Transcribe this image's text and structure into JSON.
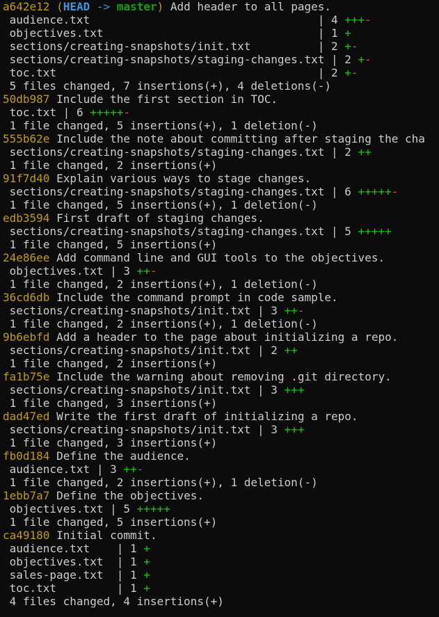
{
  "terminal": {
    "colors": {
      "background": "#0c0c0c",
      "text": "#cccccc",
      "hash": "#c19c00",
      "head": "#3a96dd",
      "branch": "#13a10e",
      "insertions": "#16c60c",
      "deletions": "#e74856"
    },
    "head_ref": {
      "open_paren": "(",
      "head": "HEAD",
      "arrow": "->",
      "branch": "master",
      "close_paren": ")"
    },
    "commits": [
      {
        "hash": "a642e12",
        "message": "Add header to all pages.",
        "files": [
          {
            "path": "audience.txt                                 ",
            "count": "4",
            "plus": "+++",
            "minus": "-"
          },
          {
            "path": "objectives.txt                               ",
            "count": "1",
            "plus": "+",
            "minus": ""
          },
          {
            "path": "sections/creating-snapshots/init.txt         ",
            "count": "2",
            "plus": "+",
            "minus": "-"
          },
          {
            "path": "sections/creating-snapshots/staging-changes.txt",
            "count": "2",
            "plus": "+",
            "minus": "-"
          },
          {
            "path": "toc.txt                                      ",
            "count": "2",
            "plus": "+",
            "minus": "-"
          }
        ],
        "summary": "5 files changed, 7 insertions(+), 4 deletions(-)"
      },
      {
        "hash": "50db987",
        "message": "Include the first section in TOC.",
        "files": [
          {
            "path": "toc.txt",
            "count": "6",
            "plus": "+++++",
            "minus": "-"
          }
        ],
        "summary": "1 file changed, 5 insertions(+), 1 deletion(-)"
      },
      {
        "hash": "555b62e",
        "message": "Include the note about committing after staging the cha",
        "files": [
          {
            "path": "sections/creating-snapshots/staging-changes.txt",
            "count": "2",
            "plus": "++",
            "minus": ""
          }
        ],
        "summary": "1 file changed, 2 insertions(+)"
      },
      {
        "hash": "91f7d40",
        "message": "Explain various ways to stage changes.",
        "files": [
          {
            "path": "sections/creating-snapshots/staging-changes.txt",
            "count": "6",
            "plus": "+++++",
            "minus": "-"
          }
        ],
        "summary": "1 file changed, 5 insertions(+), 1 deletion(-)"
      },
      {
        "hash": "edb3594",
        "message": "First draft of staging changes.",
        "files": [
          {
            "path": "sections/creating-snapshots/staging-changes.txt",
            "count": "5",
            "plus": "+++++",
            "minus": ""
          }
        ],
        "summary": "1 file changed, 5 insertions(+)"
      },
      {
        "hash": "24e86ee",
        "message": "Add command line and GUI tools to the objectives.",
        "files": [
          {
            "path": "objectives.txt",
            "count": "3",
            "plus": "++",
            "minus": "-"
          }
        ],
        "summary": "1 file changed, 2 insertions(+), 1 deletion(-)"
      },
      {
        "hash": "36cd6db",
        "message": "Include the command prompt in code sample.",
        "files": [
          {
            "path": "sections/creating-snapshots/init.txt",
            "count": "3",
            "plus": "++",
            "minus": "-"
          }
        ],
        "summary": "1 file changed, 2 insertions(+), 1 deletion(-)"
      },
      {
        "hash": "9b6ebfd",
        "message": "Add a header to the page about initializing a repo.",
        "files": [
          {
            "path": "sections/creating-snapshots/init.txt",
            "count": "2",
            "plus": "++",
            "minus": ""
          }
        ],
        "summary": "1 file changed, 2 insertions(+)"
      },
      {
        "hash": "fa1b75e",
        "message": "Include the warning about removing .git directory.",
        "files": [
          {
            "path": "sections/creating-snapshots/init.txt",
            "count": "3",
            "plus": "+++",
            "minus": ""
          }
        ],
        "summary": "1 file changed, 3 insertions(+)"
      },
      {
        "hash": "dad47ed",
        "message": "Write the first draft of initializing a repo.",
        "files": [
          {
            "path": "sections/creating-snapshots/init.txt",
            "count": "3",
            "plus": "+++",
            "minus": ""
          }
        ],
        "summary": "1 file changed, 3 insertions(+)"
      },
      {
        "hash": "fb0d184",
        "message": "Define the audience.",
        "files": [
          {
            "path": "audience.txt",
            "count": "3",
            "plus": "++",
            "minus": "-"
          }
        ],
        "summary": "1 file changed, 2 insertions(+), 1 deletion(-)"
      },
      {
        "hash": "1ebb7a7",
        "message": "Define the objectives.",
        "files": [
          {
            "path": "objectives.txt",
            "count": "5",
            "plus": "+++++",
            "minus": ""
          }
        ],
        "summary": "1 file changed, 5 insertions(+)"
      },
      {
        "hash": "ca49180",
        "message": "Initial commit.",
        "files": [
          {
            "path": "audience.txt   ",
            "count": "1",
            "plus": "+",
            "minus": ""
          },
          {
            "path": "objectives.txt ",
            "count": "1",
            "plus": "+",
            "minus": ""
          },
          {
            "path": "sales-page.txt ",
            "count": "1",
            "plus": "+",
            "minus": ""
          },
          {
            "path": "toc.txt        ",
            "count": "1",
            "plus": "+",
            "minus": ""
          }
        ],
        "summary": "4 files changed, 4 insertions(+)"
      }
    ]
  }
}
